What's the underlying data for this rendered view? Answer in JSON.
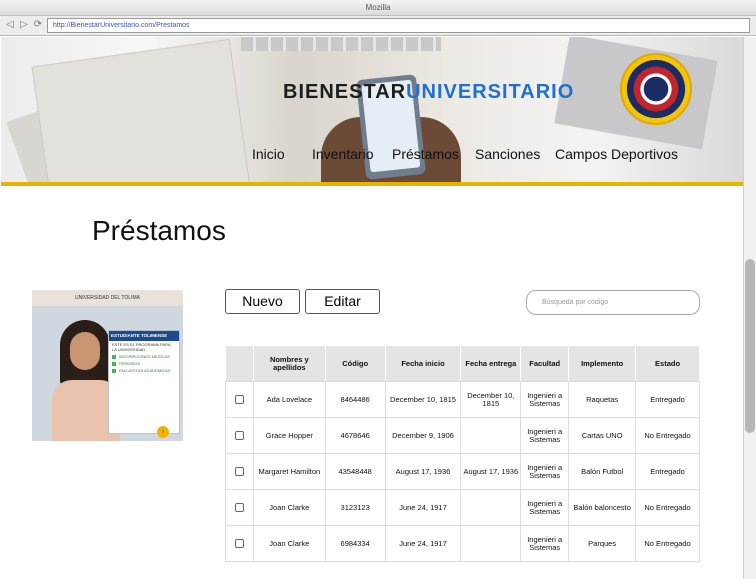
{
  "browser": {
    "title": "Mozilla",
    "url": "http://BienestarUniversitario.com/Prestamos",
    "icons": [
      "back-icon",
      "forward-icon",
      "reload-icon"
    ]
  },
  "header": {
    "logo_part1": "BIENESTAR",
    "logo_part2": "UNIVERSITARIO",
    "nav": [
      "Inicio",
      "Inventario",
      "Préstamos",
      "Sanciones",
      "Campos Deportivos"
    ],
    "colors": {
      "accent": "#e8b300",
      "brand_blue": "#1d6fd0"
    }
  },
  "page": {
    "title": "Préstamos",
    "new_label": "Nuevo",
    "edit_label": "Editar",
    "search_placeholder": "Búsqueda por código"
  },
  "banner": {
    "top": "UNIVERSIDAD DEL TOLIMA",
    "head": "ESTUDIANTE TOLIMENSE",
    "line": "ESTE ES EL PROGRAMA PARA LA UNIVERSIDAD",
    "items": [
      "INSCRIPCIONES MEDICAS",
      "PERMISOS",
      "ENCUESTAS ACADEMICAS"
    ]
  },
  "table": {
    "headers": [
      "",
      "Nombres y apellidos",
      "Código",
      "Fecha inicio",
      "Fecha entrega",
      "Facultad",
      "Implemento",
      "Estado"
    ],
    "rows": [
      [
        "Ada Lovelace",
        "8464486",
        "December 10, 1815",
        "December 10, 1815",
        "Ingenieri a Sistemas",
        "Raquetas",
        "Entregado"
      ],
      [
        "Grace Hopper",
        "4678646",
        "December 9, 1906",
        "",
        "Ingenieri a Sistemas",
        "Cartas UNO",
        "No Entregado"
      ],
      [
        "Margaret Hamilton",
        "43548448",
        "August 17, 1936",
        "August 17, 1936",
        "Ingenieri a Sistemas",
        "Balón Futbol",
        "Entregado"
      ],
      [
        "Joan Clarke",
        "3123123",
        "June 24, 1917",
        "",
        "Ingenieri a Sistemas",
        "Balón baloncesto",
        "No Entregado"
      ],
      [
        "Joan Clarke",
        "6984334",
        "June 24, 1917",
        "",
        "Ingenieri a Sistemas",
        "Parques",
        "No Entregado"
      ]
    ]
  }
}
